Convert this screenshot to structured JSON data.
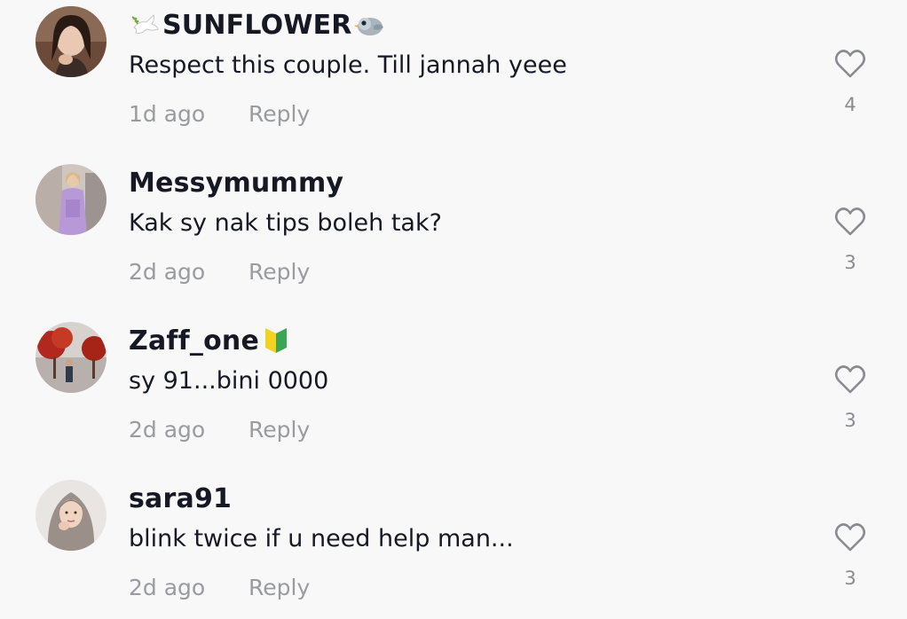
{
  "comments": [
    {
      "username": "SUNFLOWER",
      "prefix_emoji": "dove-emoji",
      "suffix_emoji": "bird-emoji",
      "text": "Respect this couple. Till jannah yeee",
      "time": "1d ago",
      "reply_label": "Reply",
      "likes": "4",
      "avatar": "avatar-photo-woman"
    },
    {
      "username": "Messymummy",
      "text": "Kak sy nak tips boleh tak?",
      "time": "2d ago",
      "reply_label": "Reply",
      "likes": "3",
      "avatar": "avatar-photo-purple-dress"
    },
    {
      "username": "Zaff_one",
      "suffix_emoji": "japanese-beginner-symbol-emoji",
      "text": "sy 91...bini 0000",
      "time": "2d ago",
      "reply_label": "Reply",
      "likes": "3",
      "avatar": "avatar-photo-red-trees"
    },
    {
      "username": "sara91",
      "text": "blink twice if u need help man...",
      "time": "2d ago",
      "reply_label": "Reply",
      "likes": "3",
      "avatar": "avatar-photo-hijab"
    }
  ],
  "icons": {
    "like": "heart-outline-icon"
  },
  "colors": {
    "background": "#f8f8f8",
    "username": "#161823",
    "meta": "#9a9ba0",
    "icon_stroke": "#8a8b91"
  }
}
